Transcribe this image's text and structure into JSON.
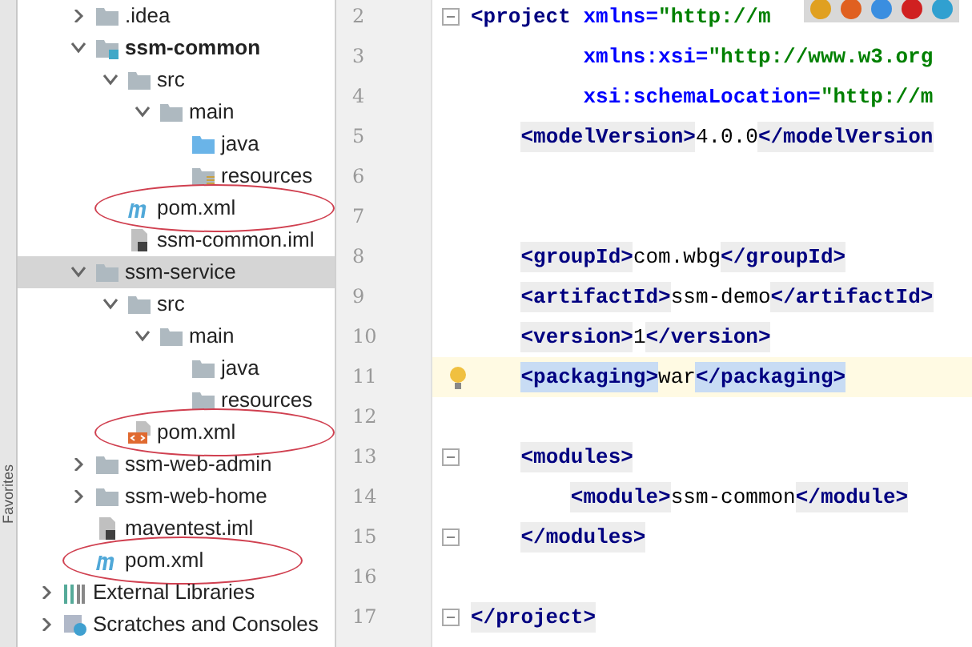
{
  "side_stripe": {
    "label": "Favorites"
  },
  "project_tree": [
    {
      "children": [
        {
          "label": ".idea",
          "kind": "folder",
          "expanded": false,
          "selected": false
        },
        {
          "label": "ssm-common",
          "kind": "module",
          "bold": true,
          "expanded": true,
          "selected": false,
          "children": [
            {
              "label": "src",
              "kind": "folder",
              "expanded": true,
              "selected": false,
              "children": [
                {
                  "label": "main",
                  "kind": "folder",
                  "expanded": true,
                  "selected": false,
                  "children": [
                    {
                      "label": "java",
                      "kind": "source-folder",
                      "selected": false
                    },
                    {
                      "label": "resources",
                      "kind": "resources-folder",
                      "selected": false
                    }
                  ]
                }
              ]
            },
            {
              "label": "pom.xml",
              "kind": "maven",
              "circled": true,
              "selected": false
            },
            {
              "label": "ssm-common.iml",
              "kind": "iml",
              "selected": false
            }
          ]
        },
        {
          "label": "ssm-service",
          "kind": "folder",
          "bold": false,
          "expanded": true,
          "selected": true,
          "children": [
            {
              "label": "src",
              "kind": "folder",
              "expanded": true,
              "selected": false,
              "children": [
                {
                  "label": "main",
                  "kind": "folder",
                  "expanded": true,
                  "selected": false,
                  "children": [
                    {
                      "label": "java",
                      "kind": "folder",
                      "selected": false
                    },
                    {
                      "label": "resources",
                      "kind": "folder",
                      "selected": false
                    }
                  ]
                }
              ]
            },
            {
              "label": "pom.xml",
              "kind": "xml",
              "circled": true,
              "selected": false
            }
          ]
        },
        {
          "label": "ssm-web-admin",
          "kind": "folder",
          "expanded": false,
          "selected": false
        },
        {
          "label": "ssm-web-home",
          "kind": "folder",
          "expanded": false,
          "selected": false
        },
        {
          "label": "maventest.iml",
          "kind": "iml",
          "selected": false
        },
        {
          "label": "pom.xml",
          "kind": "maven",
          "circled": true,
          "selected": false
        }
      ]
    },
    {
      "label": "External Libraries",
      "kind": "libraries",
      "expanded": false,
      "selected": false
    },
    {
      "label": "Scratches and Consoles",
      "kind": "scratches",
      "expanded": false,
      "selected": false
    }
  ],
  "editor": {
    "lines": [
      {
        "number": "2",
        "fold": true,
        "segments": [
          {
            "kind": "tag-plain",
            "text": "<project "
          },
          {
            "kind": "attr",
            "text": "xmlns="
          },
          {
            "kind": "string",
            "text": "\"http://m"
          }
        ]
      },
      {
        "number": "3",
        "segments": [
          {
            "kind": "attr",
            "text": "         xmlns:xsi="
          },
          {
            "kind": "string",
            "text": "\"http://www.w3.org"
          }
        ]
      },
      {
        "number": "4",
        "segments": [
          {
            "kind": "attr",
            "text": "         xsi:schemaLocation="
          },
          {
            "kind": "string",
            "text": "\"http://m"
          }
        ]
      },
      {
        "number": "5",
        "segments": [
          {
            "kind": "tag",
            "text": "    <modelVersion>"
          },
          {
            "kind": "text",
            "text": "4.0.0"
          },
          {
            "kind": "tag",
            "text": "</modelVersion"
          }
        ]
      },
      {
        "number": "6"
      },
      {
        "number": "7"
      },
      {
        "number": "8",
        "segments": [
          {
            "kind": "tag",
            "text": "    <groupId>"
          },
          {
            "kind": "text",
            "text": "com.wbg"
          },
          {
            "kind": "tag",
            "text": "</groupId>"
          }
        ]
      },
      {
        "number": "9",
        "segments": [
          {
            "kind": "tag",
            "text": "    <artifactId>"
          },
          {
            "kind": "text",
            "text": "ssm-demo"
          },
          {
            "kind": "tag",
            "text": "</artifactId>"
          }
        ]
      },
      {
        "number": "10",
        "segments": [
          {
            "kind": "tag",
            "text": "    <version>"
          },
          {
            "kind": "text",
            "text": "1"
          },
          {
            "kind": "tag",
            "text": "</version>"
          }
        ]
      },
      {
        "number": "11",
        "current": true,
        "intention": true,
        "segments": [
          {
            "kind": "tag",
            "text": "    <packaging>"
          },
          {
            "kind": "text",
            "text": "war"
          },
          {
            "kind": "tag",
            "text": "</packaging>"
          }
        ]
      },
      {
        "number": "12"
      },
      {
        "number": "13",
        "fold": true,
        "segments": [
          {
            "kind": "tag",
            "text": "    <modules>"
          }
        ]
      },
      {
        "number": "14",
        "segments": [
          {
            "kind": "tag",
            "text": "        <module>"
          },
          {
            "kind": "text",
            "text": "ssm-common"
          },
          {
            "kind": "tag",
            "text": "</module>"
          }
        ]
      },
      {
        "number": "15",
        "fold": true,
        "segments": [
          {
            "kind": "tag",
            "text": "    </modules>"
          }
        ]
      },
      {
        "number": "16"
      },
      {
        "number": "17",
        "fold": true,
        "segments": [
          {
            "kind": "tag",
            "text": "</project>"
          }
        ]
      }
    ]
  },
  "browser_popup": {
    "browsers": [
      {
        "color": "#e0a020"
      },
      {
        "color": "#e06020"
      },
      {
        "color": "#3a8ee0"
      },
      {
        "color": "#d02020"
      },
      {
        "color": "#30a0d0"
      }
    ]
  }
}
